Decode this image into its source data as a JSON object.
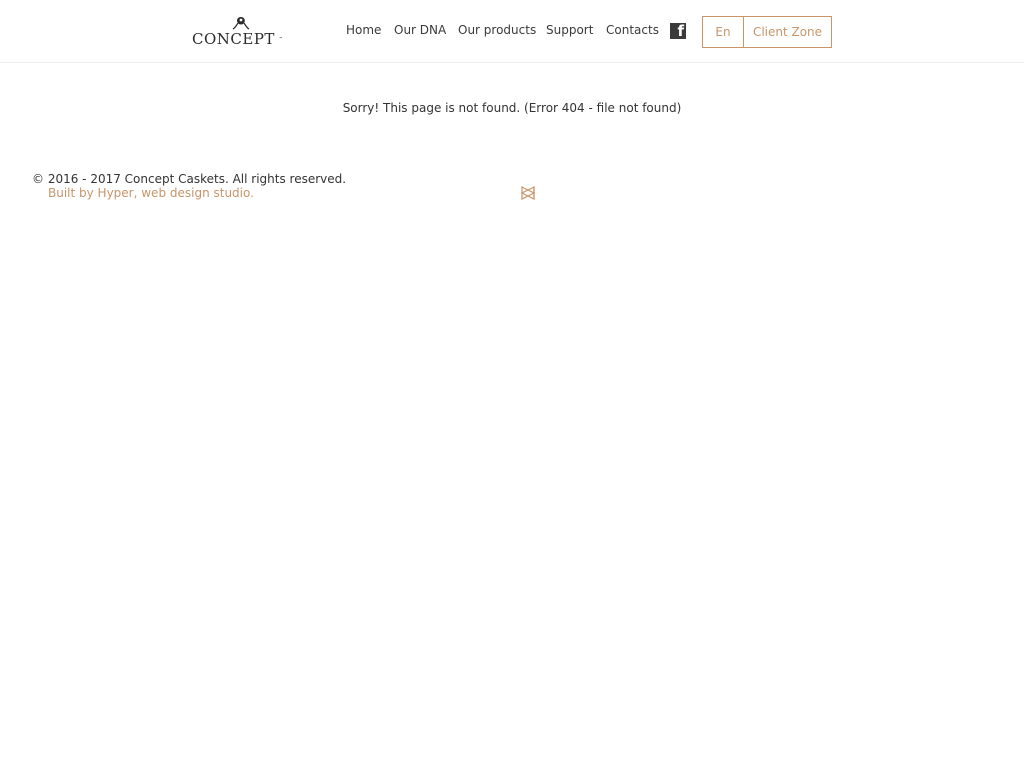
{
  "header": {
    "logo": {
      "text": "CONCEPT",
      "tm": "™"
    },
    "nav": [
      {
        "label": "Home"
      },
      {
        "label": "Our DNA"
      },
      {
        "label": "Our products"
      },
      {
        "label": "Support"
      },
      {
        "label": "Contacts"
      }
    ],
    "social_icon": "facebook-icon",
    "language_label": "En",
    "client_zone_label": "Client Zone"
  },
  "main": {
    "error_message": "Sorry! This page is not found. (Error 404 - file not found)"
  },
  "footer": {
    "copyright": "© 2016 - 2017 Concept Caskets. All rights reserved.",
    "built_by": "Built by Hyper, web design studio.",
    "studio_icon": "hyper-logo-icon"
  },
  "colors": {
    "accent": "#c8956a",
    "text": "#333333",
    "divider": "#eeeeee"
  }
}
